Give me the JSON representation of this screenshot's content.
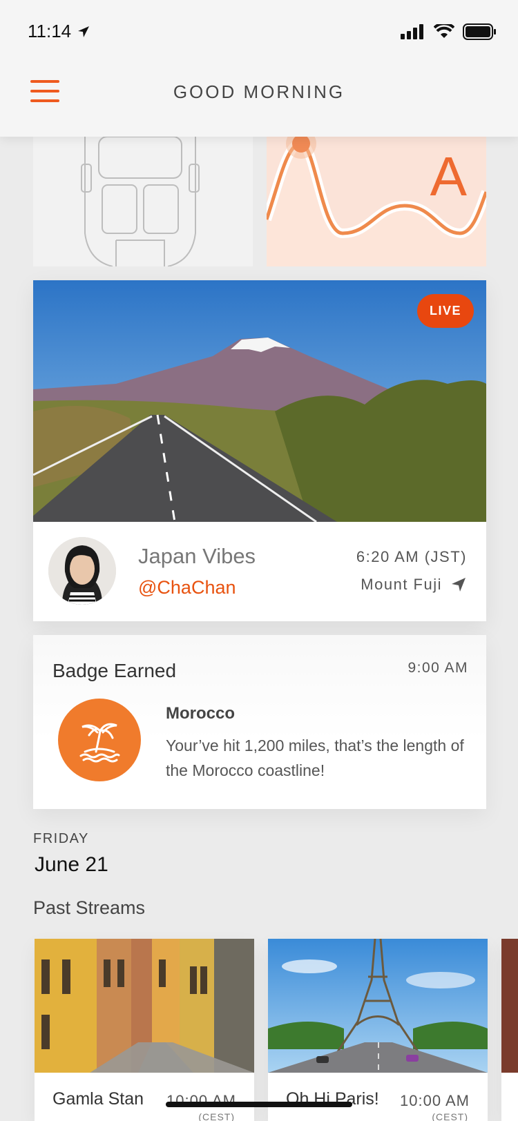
{
  "status_bar": {
    "time": "11:14"
  },
  "header": {
    "title": "GOOD MORNING"
  },
  "top_cards": {
    "wave_letter": "A"
  },
  "live_stream": {
    "badge": "LIVE",
    "title": "Japan Vibes",
    "handle": "@ChaChan",
    "time": "6:20 AM (JST)",
    "location": "Mount Fuji"
  },
  "badge_card": {
    "heading": "Badge Earned",
    "time": "9:00 AM",
    "place": "Morocco",
    "description": "Your’ve hit 1,200 miles, that’s the length of the Morocco coastline!"
  },
  "date_section": {
    "day": "FRIDAY",
    "date": "June 21",
    "past_title": "Past Streams"
  },
  "past_streams": [
    {
      "name": "Gamla Stan",
      "time": "10:00 AM",
      "zone": "(CEST)"
    },
    {
      "name": "Oh Hi Paris!",
      "time": "10:00 AM",
      "zone": "(CEST)"
    }
  ],
  "colors": {
    "accent": "#e8520f",
    "badge": "#f07b2c"
  }
}
